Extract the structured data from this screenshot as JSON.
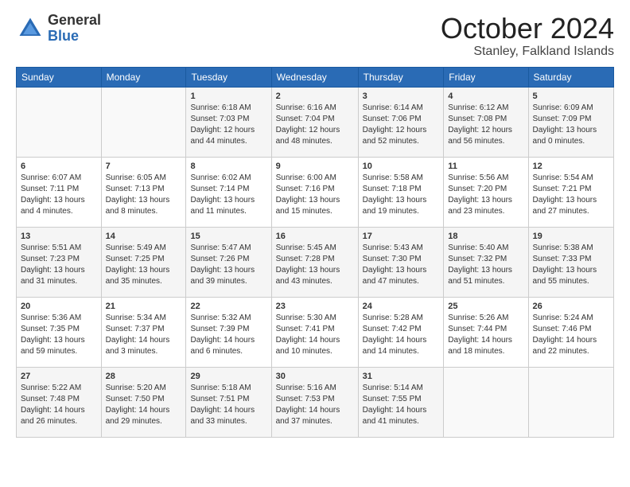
{
  "header": {
    "logo_general": "General",
    "logo_blue": "Blue",
    "month_year": "October 2024",
    "location": "Stanley, Falkland Islands"
  },
  "days_of_week": [
    "Sunday",
    "Monday",
    "Tuesday",
    "Wednesday",
    "Thursday",
    "Friday",
    "Saturday"
  ],
  "weeks": [
    [
      {
        "day": "",
        "sunrise": "",
        "sunset": "",
        "daylight": ""
      },
      {
        "day": "",
        "sunrise": "",
        "sunset": "",
        "daylight": ""
      },
      {
        "day": "1",
        "sunrise": "Sunrise: 6:18 AM",
        "sunset": "Sunset: 7:03 PM",
        "daylight": "Daylight: 12 hours and 44 minutes."
      },
      {
        "day": "2",
        "sunrise": "Sunrise: 6:16 AM",
        "sunset": "Sunset: 7:04 PM",
        "daylight": "Daylight: 12 hours and 48 minutes."
      },
      {
        "day": "3",
        "sunrise": "Sunrise: 6:14 AM",
        "sunset": "Sunset: 7:06 PM",
        "daylight": "Daylight: 12 hours and 52 minutes."
      },
      {
        "day": "4",
        "sunrise": "Sunrise: 6:12 AM",
        "sunset": "Sunset: 7:08 PM",
        "daylight": "Daylight: 12 hours and 56 minutes."
      },
      {
        "day": "5",
        "sunrise": "Sunrise: 6:09 AM",
        "sunset": "Sunset: 7:09 PM",
        "daylight": "Daylight: 13 hours and 0 minutes."
      }
    ],
    [
      {
        "day": "6",
        "sunrise": "Sunrise: 6:07 AM",
        "sunset": "Sunset: 7:11 PM",
        "daylight": "Daylight: 13 hours and 4 minutes."
      },
      {
        "day": "7",
        "sunrise": "Sunrise: 6:05 AM",
        "sunset": "Sunset: 7:13 PM",
        "daylight": "Daylight: 13 hours and 8 minutes."
      },
      {
        "day": "8",
        "sunrise": "Sunrise: 6:02 AM",
        "sunset": "Sunset: 7:14 PM",
        "daylight": "Daylight: 13 hours and 11 minutes."
      },
      {
        "day": "9",
        "sunrise": "Sunrise: 6:00 AM",
        "sunset": "Sunset: 7:16 PM",
        "daylight": "Daylight: 13 hours and 15 minutes."
      },
      {
        "day": "10",
        "sunrise": "Sunrise: 5:58 AM",
        "sunset": "Sunset: 7:18 PM",
        "daylight": "Daylight: 13 hours and 19 minutes."
      },
      {
        "day": "11",
        "sunrise": "Sunrise: 5:56 AM",
        "sunset": "Sunset: 7:20 PM",
        "daylight": "Daylight: 13 hours and 23 minutes."
      },
      {
        "day": "12",
        "sunrise": "Sunrise: 5:54 AM",
        "sunset": "Sunset: 7:21 PM",
        "daylight": "Daylight: 13 hours and 27 minutes."
      }
    ],
    [
      {
        "day": "13",
        "sunrise": "Sunrise: 5:51 AM",
        "sunset": "Sunset: 7:23 PM",
        "daylight": "Daylight: 13 hours and 31 minutes."
      },
      {
        "day": "14",
        "sunrise": "Sunrise: 5:49 AM",
        "sunset": "Sunset: 7:25 PM",
        "daylight": "Daylight: 13 hours and 35 minutes."
      },
      {
        "day": "15",
        "sunrise": "Sunrise: 5:47 AM",
        "sunset": "Sunset: 7:26 PM",
        "daylight": "Daylight: 13 hours and 39 minutes."
      },
      {
        "day": "16",
        "sunrise": "Sunrise: 5:45 AM",
        "sunset": "Sunset: 7:28 PM",
        "daylight": "Daylight: 13 hours and 43 minutes."
      },
      {
        "day": "17",
        "sunrise": "Sunrise: 5:43 AM",
        "sunset": "Sunset: 7:30 PM",
        "daylight": "Daylight: 13 hours and 47 minutes."
      },
      {
        "day": "18",
        "sunrise": "Sunrise: 5:40 AM",
        "sunset": "Sunset: 7:32 PM",
        "daylight": "Daylight: 13 hours and 51 minutes."
      },
      {
        "day": "19",
        "sunrise": "Sunrise: 5:38 AM",
        "sunset": "Sunset: 7:33 PM",
        "daylight": "Daylight: 13 hours and 55 minutes."
      }
    ],
    [
      {
        "day": "20",
        "sunrise": "Sunrise: 5:36 AM",
        "sunset": "Sunset: 7:35 PM",
        "daylight": "Daylight: 13 hours and 59 minutes."
      },
      {
        "day": "21",
        "sunrise": "Sunrise: 5:34 AM",
        "sunset": "Sunset: 7:37 PM",
        "daylight": "Daylight: 14 hours and 3 minutes."
      },
      {
        "day": "22",
        "sunrise": "Sunrise: 5:32 AM",
        "sunset": "Sunset: 7:39 PM",
        "daylight": "Daylight: 14 hours and 6 minutes."
      },
      {
        "day": "23",
        "sunrise": "Sunrise: 5:30 AM",
        "sunset": "Sunset: 7:41 PM",
        "daylight": "Daylight: 14 hours and 10 minutes."
      },
      {
        "day": "24",
        "sunrise": "Sunrise: 5:28 AM",
        "sunset": "Sunset: 7:42 PM",
        "daylight": "Daylight: 14 hours and 14 minutes."
      },
      {
        "day": "25",
        "sunrise": "Sunrise: 5:26 AM",
        "sunset": "Sunset: 7:44 PM",
        "daylight": "Daylight: 14 hours and 18 minutes."
      },
      {
        "day": "26",
        "sunrise": "Sunrise: 5:24 AM",
        "sunset": "Sunset: 7:46 PM",
        "daylight": "Daylight: 14 hours and 22 minutes."
      }
    ],
    [
      {
        "day": "27",
        "sunrise": "Sunrise: 5:22 AM",
        "sunset": "Sunset: 7:48 PM",
        "daylight": "Daylight: 14 hours and 26 minutes."
      },
      {
        "day": "28",
        "sunrise": "Sunrise: 5:20 AM",
        "sunset": "Sunset: 7:50 PM",
        "daylight": "Daylight: 14 hours and 29 minutes."
      },
      {
        "day": "29",
        "sunrise": "Sunrise: 5:18 AM",
        "sunset": "Sunset: 7:51 PM",
        "daylight": "Daylight: 14 hours and 33 minutes."
      },
      {
        "day": "30",
        "sunrise": "Sunrise: 5:16 AM",
        "sunset": "Sunset: 7:53 PM",
        "daylight": "Daylight: 14 hours and 37 minutes."
      },
      {
        "day": "31",
        "sunrise": "Sunrise: 5:14 AM",
        "sunset": "Sunset: 7:55 PM",
        "daylight": "Daylight: 14 hours and 41 minutes."
      },
      {
        "day": "",
        "sunrise": "",
        "sunset": "",
        "daylight": ""
      },
      {
        "day": "",
        "sunrise": "",
        "sunset": "",
        "daylight": ""
      }
    ]
  ]
}
